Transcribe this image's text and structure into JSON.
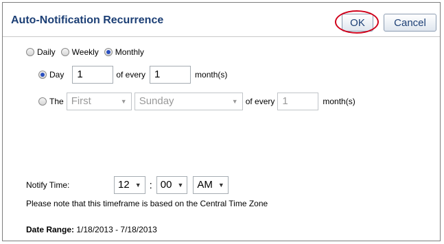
{
  "dialog": {
    "title": "Auto-Notification Recurrence",
    "ok_label": "OK",
    "cancel_label": "Cancel"
  },
  "frequency": {
    "options": [
      "Daily",
      "Weekly",
      "Monthly"
    ],
    "selected": "Monthly"
  },
  "day_row": {
    "prefix": "Day",
    "day_value": "1",
    "middle": "of every",
    "month_value": "1",
    "suffix": "month(s)"
  },
  "the_row": {
    "prefix": "The",
    "ordinal": "First",
    "weekday": "Sunday",
    "middle": "of every",
    "month_value": "1",
    "suffix": "month(s)"
  },
  "notify": {
    "label": "Notify Time:",
    "hour": "12",
    "separator": ":",
    "minute": "00",
    "ampm": "AM",
    "note": "Please note that this timeframe is based on the Central Time Zone"
  },
  "date_range": {
    "label": "Date Range:",
    "value": "1/18/2013 - 7/18/2013"
  },
  "colors": {
    "title": "#1c3f75",
    "highlight_ring": "#d0021b"
  }
}
